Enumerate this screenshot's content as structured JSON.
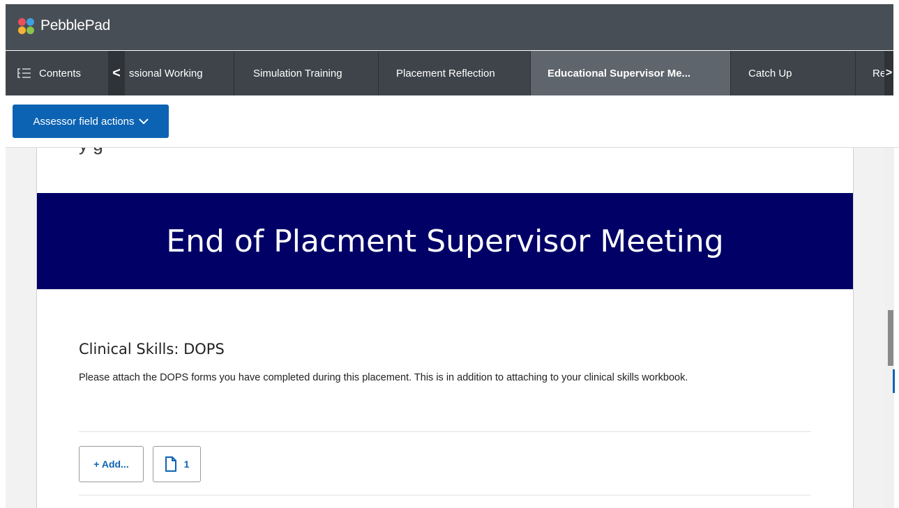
{
  "app": {
    "brand": "PebblePad"
  },
  "tabbar": {
    "contents_label": "Contents",
    "prev_glyph": "<",
    "next_glyph": ">",
    "tabs": [
      {
        "label": "ssional Working",
        "active": false
      },
      {
        "label": "Simulation Training",
        "active": false
      },
      {
        "label": "Placement Reflection",
        "active": false
      },
      {
        "label": "Educational Supervisor Me...",
        "active": true
      },
      {
        "label": "Catch Up",
        "active": false
      },
      {
        "label": "Re",
        "active": false
      }
    ]
  },
  "toolbar": {
    "assessor_label": "Assessor field actions",
    "assessor_icon": "chevron-down-icon"
  },
  "page": {
    "cut_heading": "y g",
    "banner_title": "End of Placment Supervisor Meeting",
    "section": {
      "title": "Clinical Skills: DOPS",
      "description": "Please attach the DOPS forms you have completed during this placement. This is in addition to attaching to your clinical skills workbook.",
      "add_label": "+ Add...",
      "attachment_count": "1"
    }
  },
  "colors": {
    "header_bg": "#484e55",
    "tabbar_bg": "#3f444a",
    "active_tab_bg": "#5e656d",
    "button_blue": "#0c63b3",
    "banner_navy": "#000066"
  }
}
